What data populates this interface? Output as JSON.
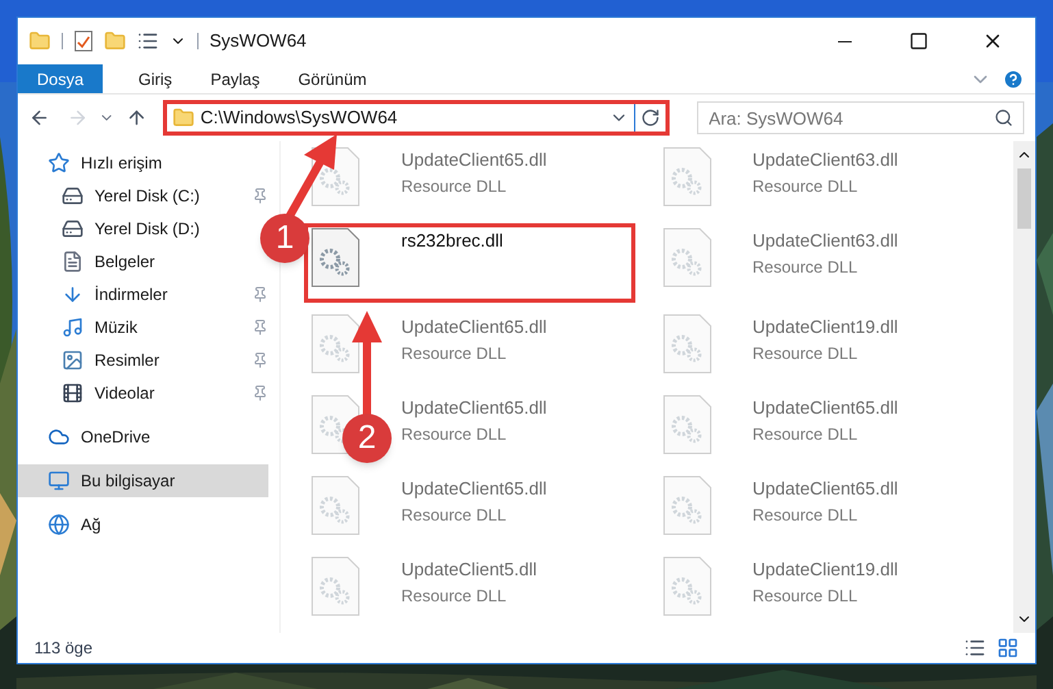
{
  "window": {
    "title": "SysWOW64"
  },
  "ribbon": {
    "tabs": [
      {
        "label": "Dosya",
        "selected": true
      },
      {
        "label": "Giriş",
        "selected": false
      },
      {
        "label": "Paylaş",
        "selected": false
      },
      {
        "label": "Görünüm",
        "selected": false
      }
    ]
  },
  "address_bar": {
    "path": "C:\\Windows\\SysWOW64",
    "highlighted": true
  },
  "search": {
    "placeholder": "Ara: SysWOW64"
  },
  "sidebar": {
    "items": [
      {
        "label": "Hızlı erişim",
        "kind": "star",
        "selected": false,
        "children": [
          {
            "label": "Yerel Disk (C:)",
            "kind": "drive-c",
            "pinned": true,
            "selected": false
          },
          {
            "label": "Yerel Disk (D:)",
            "kind": "drive",
            "pinned": false,
            "selected": false
          },
          {
            "label": "Belgeler",
            "kind": "docs",
            "pinned": false,
            "selected": false
          },
          {
            "label": "İndirmeler",
            "kind": "download",
            "pinned": true,
            "selected": false
          },
          {
            "label": "Müzik",
            "kind": "music",
            "pinned": true,
            "selected": false
          },
          {
            "label": "Resimler",
            "kind": "pictures",
            "pinned": true,
            "selected": false
          },
          {
            "label": "Videolar",
            "kind": "videos",
            "pinned": true,
            "selected": false
          }
        ]
      },
      {
        "label": "OneDrive",
        "kind": "cloud",
        "selected": false
      },
      {
        "label": "Bu bilgisayar",
        "kind": "computer",
        "selected": true
      },
      {
        "label": "Ağ",
        "kind": "network",
        "selected": false
      }
    ]
  },
  "files": [
    {
      "name": "UpdateClient65.dll",
      "type": "Resource DLL",
      "blurred": true,
      "highlighted": false
    },
    {
      "name": "UpdateClient63.dll",
      "type": "Resource DLL",
      "blurred": true,
      "highlighted": false
    },
    {
      "name": "rs232brec.dll",
      "blurred": false,
      "highlighted": true
    },
    {
      "name": "UpdateClient63.dll",
      "type": "Resource DLL",
      "blurred": true,
      "highlighted": false
    },
    {
      "name": "UpdateClient65.dll",
      "type": "Resource DLL",
      "blurred": true,
      "highlighted": false
    },
    {
      "name": "UpdateClient19.dll",
      "type": "Resource DLL",
      "blurred": true,
      "highlighted": false
    },
    {
      "name": "UpdateClient65.dll",
      "type": "Resource DLL",
      "blurred": true,
      "highlighted": false
    },
    {
      "name": "UpdateClient65.dll",
      "type": "Resource DLL",
      "blurred": true,
      "highlighted": false
    },
    {
      "name": "UpdateClient65.dll",
      "type": "Resource DLL",
      "blurred": true,
      "highlighted": false
    },
    {
      "name": "UpdateClient65.dll",
      "type": "Resource DLL",
      "blurred": true,
      "highlighted": false
    },
    {
      "name": "UpdateClient5.dll",
      "type": "Resource DLL",
      "blurred": true,
      "highlighted": false
    },
    {
      "name": "UpdateClient19.dll",
      "type": "Resource DLL",
      "blurred": true,
      "highlighted": false
    }
  ],
  "callouts": [
    {
      "label": "1"
    },
    {
      "label": "2"
    }
  ],
  "status_bar": {
    "count": "113 öge"
  }
}
